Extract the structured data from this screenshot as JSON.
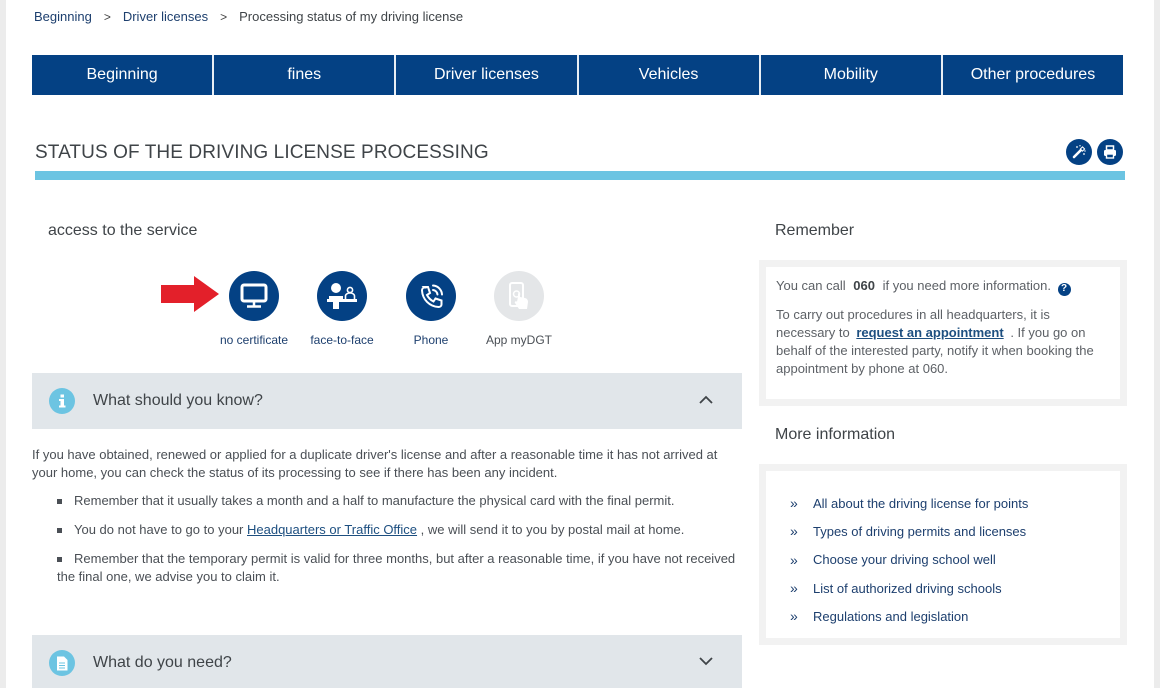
{
  "breadcrumb": {
    "items": [
      "Beginning",
      "Driver licenses"
    ],
    "current": "Processing status of my driving license",
    "separator": ">"
  },
  "nav": {
    "items": [
      "Beginning",
      "fines",
      "Driver licenses",
      "Vehicles",
      "Mobility",
      "Other procedures"
    ]
  },
  "page": {
    "title": "STATUS OF THE DRIVING LICENSE PROCESSING",
    "tools": [
      "magic-wand-icon",
      "print-icon"
    ]
  },
  "access": {
    "title": "access to the service",
    "options": [
      {
        "label": "no certificate",
        "icon": "monitor-icon",
        "highlighted": true
      },
      {
        "label": "face-to-face",
        "icon": "counter-attendant-icon"
      },
      {
        "label": "Phone",
        "icon": "phone-icon"
      },
      {
        "label": "App myDGT",
        "icon": "mobile-app-icon",
        "disabled": true
      }
    ]
  },
  "know": {
    "title": "What should you know?",
    "expanded": true,
    "intro": "If you have obtained, renewed or applied for a duplicate driver's license and after a reasonable time it has not arrived at your home, you can check the status of its processing to see if there has been any incident.",
    "bullets": [
      {
        "text": "Remember that it usually takes a month and a half to manufacture the physical card with the final permit."
      },
      {
        "prefix": "You do not have to go to your ",
        "link": "Headquarters or Traffic Office",
        "suffix": " , we will send it to you by postal mail at home."
      },
      {
        "text": "Remember that the temporary permit is valid for three months, but after a reasonable time, if you have not received the final one, we advise you to claim it."
      }
    ]
  },
  "need": {
    "title": "What do you need?",
    "expanded": false
  },
  "remember": {
    "title": "Remember",
    "call_prefix": "You can call",
    "call_number": "060",
    "call_suffix": "if you need more information.",
    "help_glyph": "?",
    "appointment_prefix": "To carry out procedures in all headquarters, it is necessary to",
    "appointment_link": "request an appointment",
    "appointment_suffix": ". If you go on behalf of the interested party, notify it when booking the appointment by phone at 060."
  },
  "more_info": {
    "title": "More information",
    "links": [
      "All about the driving license for points",
      "Types of driving permits and licenses",
      "Choose your driving school well",
      "List of authorized driving schools",
      "Regulations and legislation"
    ]
  },
  "colors": {
    "nav_blue": "#044184",
    "accent_cyan": "#6cc4e2",
    "arrow_red": "#e3202a",
    "panel_gray": "#e1e6ea"
  }
}
